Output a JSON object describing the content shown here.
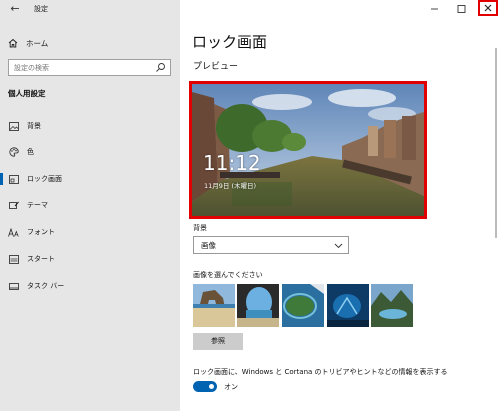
{
  "window": {
    "back_icon": "←",
    "title": "設定",
    "controls": [
      "minimize-icon",
      "maximize-icon",
      "close-icon"
    ],
    "close_highlight_color": "#e00000"
  },
  "sidebar": {
    "home_label": "ホーム",
    "search_placeholder": "設定の検索",
    "section_title": "個人用設定",
    "items": [
      {
        "label": "背景",
        "icon": "picture-icon"
      },
      {
        "label": "色",
        "icon": "palette-icon"
      },
      {
        "label": "ロック画面",
        "icon": "lock-screen-icon",
        "active": true
      },
      {
        "label": "テーマ",
        "icon": "theme-icon"
      },
      {
        "label": "フォント",
        "icon": "font-icon"
      },
      {
        "label": "スタート",
        "icon": "start-icon"
      },
      {
        "label": "タスク バー",
        "icon": "taskbar-icon"
      }
    ],
    "active_color": "#0063b1"
  },
  "main": {
    "title": "ロック画面",
    "preview_label": "プレビュー",
    "preview": {
      "time": "11:12",
      "date": "11月9日 (木曜日)"
    },
    "background_label": "背景",
    "background_value": "画像",
    "choose_label": "画像を選んでください",
    "thumbnails": [
      "beach-rock-arch",
      "cave-beach",
      "island-aerial",
      "underwater-blue",
      "mountain-lake"
    ],
    "browse_label": "参照",
    "info_label": "ロック画面に、Windows と Cortana のトリビアやヒントなどの情報を表示する",
    "toggle_label": "オン",
    "toggle_on": true,
    "accent_color": "#0063b1"
  }
}
